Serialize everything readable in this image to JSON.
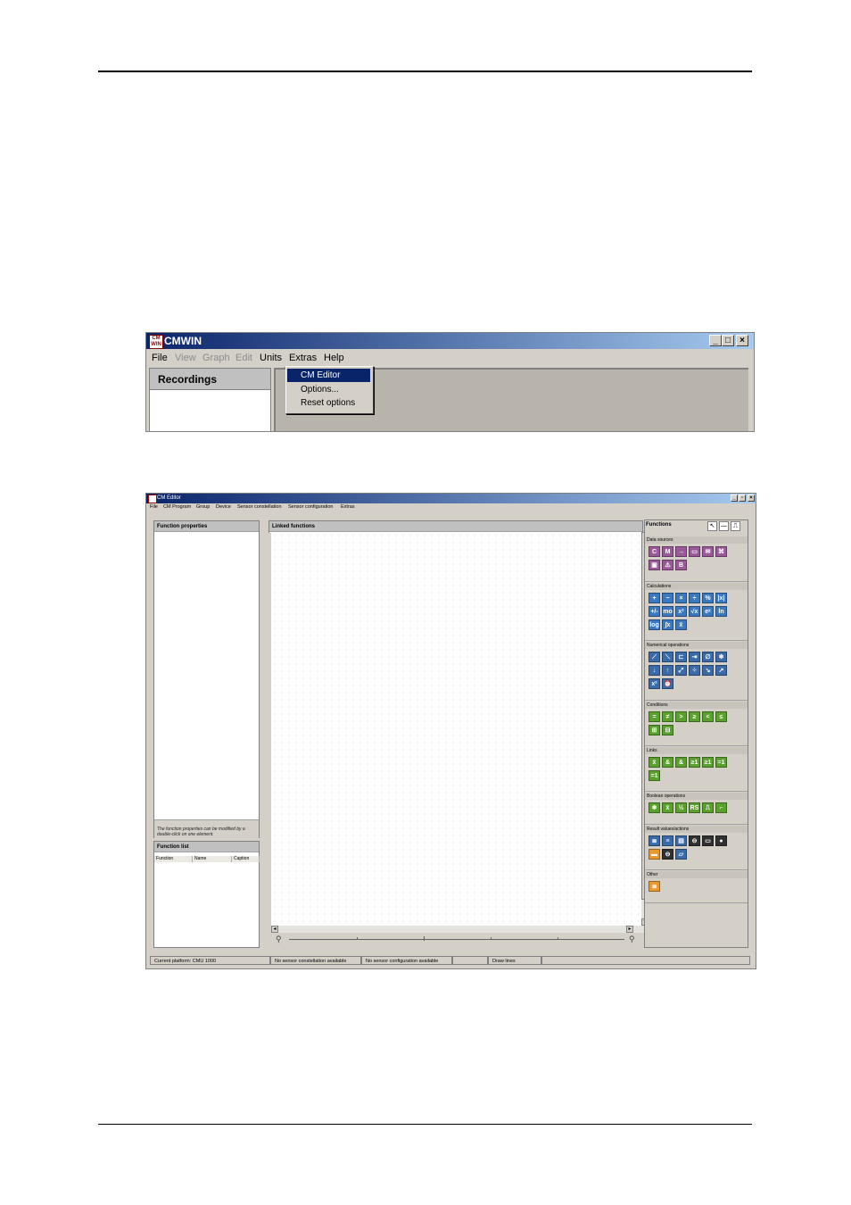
{
  "shot1": {
    "window_title": "CMWIN",
    "app_icon_text": "CM WIN",
    "menu": [
      "File",
      "View",
      "Graph",
      "Edit",
      "Units",
      "Extras",
      "Help"
    ],
    "recordings_label": "Recordings",
    "extras_dropdown": [
      "CM Editor",
      "Options...",
      "Reset options"
    ]
  },
  "shot2": {
    "window_title": "CM Editor",
    "menu": [
      "File",
      "CM Program",
      "Group",
      "Device",
      "Sensor constellation",
      "Sensor configuration",
      "Extras"
    ],
    "function_properties_title": "Function properties",
    "properties_hint": "The function properties can be modified by a double-click on one element.",
    "function_list_title": "Function list",
    "function_list_columns": [
      "Function",
      "Name",
      "Caption"
    ],
    "linked_functions_title": "Linked functions",
    "functions_title": "Functions",
    "groups": [
      {
        "title": "Data sources",
        "icons": [
          {
            "name": "constant-icon",
            "glyph": "C",
            "color": "pu"
          },
          {
            "name": "memory-icon",
            "glyph": "M",
            "color": "pu"
          },
          {
            "name": "input-icon",
            "glyph": "→",
            "color": "pu"
          },
          {
            "name": "sensor-icon",
            "glyph": "▭",
            "color": "pu"
          },
          {
            "name": "message-icon",
            "glyph": "✉",
            "color": "pu"
          },
          {
            "name": "channel-icon",
            "glyph": "⌘",
            "color": "pu"
          },
          {
            "name": "device-icon",
            "glyph": "▣",
            "color": "pu"
          },
          {
            "name": "warning-icon",
            "glyph": "⚠",
            "color": "pu"
          },
          {
            "name": "bit-icon",
            "glyph": "B",
            "color": "pu"
          }
        ]
      },
      {
        "title": "Calculations",
        "icons": [
          {
            "name": "add-icon",
            "glyph": "+",
            "color": "bl"
          },
          {
            "name": "subtract-icon",
            "glyph": "−",
            "color": "bl"
          },
          {
            "name": "multiply-icon",
            "glyph": "×",
            "color": "bl"
          },
          {
            "name": "divide-icon",
            "glyph": "÷",
            "color": "bl"
          },
          {
            "name": "percent-icon",
            "glyph": "%",
            "color": "bl"
          },
          {
            "name": "absolute-icon",
            "glyph": "|x|",
            "color": "bl"
          },
          {
            "name": "sign-icon",
            "glyph": "+/-",
            "color": "bl"
          },
          {
            "name": "modulo-icon",
            "glyph": "mo",
            "color": "bl"
          },
          {
            "name": "power-icon",
            "glyph": "x²",
            "color": "bl"
          },
          {
            "name": "sqrt-icon",
            "glyph": "√x",
            "color": "bl"
          },
          {
            "name": "exp-icon",
            "glyph": "eˣ",
            "color": "bl"
          },
          {
            "name": "ln-icon",
            "glyph": "ln",
            "color": "bl"
          },
          {
            "name": "log-icon",
            "glyph": "log",
            "color": "bl"
          },
          {
            "name": "integral-icon",
            "glyph": "∫x",
            "color": "bl"
          },
          {
            "name": "mean-icon",
            "glyph": "x̄",
            "color": "bl"
          }
        ]
      },
      {
        "title": "Numerical operations",
        "icons": [
          {
            "name": "ramp-up-icon",
            "glyph": "⟋",
            "color": "bl2"
          },
          {
            "name": "ramp-down-icon",
            "glyph": "⟍",
            "color": "bl2"
          },
          {
            "name": "step-icon",
            "glyph": "⊏",
            "color": "bl2"
          },
          {
            "name": "shift-icon",
            "glyph": "⇥",
            "color": "bl2"
          },
          {
            "name": "empty-icon",
            "glyph": "∅",
            "color": "bl2"
          },
          {
            "name": "freeze-icon",
            "glyph": "❄",
            "color": "bl2"
          },
          {
            "name": "min-icon",
            "glyph": "↓",
            "color": "bl2"
          },
          {
            "name": "max-icon",
            "glyph": "↑",
            "color": "bl2"
          },
          {
            "name": "scale-icon",
            "glyph": "⤢",
            "color": "bl2"
          },
          {
            "name": "scatter-icon",
            "glyph": "⁘",
            "color": "bl2"
          },
          {
            "name": "decay-icon",
            "glyph": "↘",
            "color": "bl2"
          },
          {
            "name": "trend-icon",
            "glyph": "↗",
            "color": "bl2"
          },
          {
            "name": "bits-icon",
            "glyph": "x²",
            "color": "bl2"
          },
          {
            "name": "timer-icon",
            "glyph": "⏰",
            "color": "bl2"
          }
        ]
      },
      {
        "title": "Conditions",
        "icons": [
          {
            "name": "equal-icon",
            "glyph": "=",
            "color": "gr"
          },
          {
            "name": "not-equal-icon",
            "glyph": "≠",
            "color": "gr"
          },
          {
            "name": "greater-icon",
            "glyph": ">",
            "color": "gr"
          },
          {
            "name": "greater-equal-icon",
            "glyph": "≥",
            "color": "gr"
          },
          {
            "name": "less-icon",
            "glyph": "<",
            "color": "gr"
          },
          {
            "name": "less-equal-icon",
            "glyph": "≤",
            "color": "gr"
          },
          {
            "name": "range-in-icon",
            "glyph": "⊞",
            "color": "gr"
          },
          {
            "name": "range-out-icon",
            "glyph": "⊟",
            "color": "gr"
          }
        ]
      },
      {
        "title": "Links",
        "icons": [
          {
            "name": "not-icon",
            "glyph": "x̄",
            "color": "gr"
          },
          {
            "name": "and-icon",
            "glyph": "&",
            "color": "gr"
          },
          {
            "name": "nand-icon",
            "glyph": "&",
            "color": "gr"
          },
          {
            "name": "or-icon",
            "glyph": "≥1",
            "color": "gr"
          },
          {
            "name": "nor-icon",
            "glyph": "≥1",
            "color": "gr"
          },
          {
            "name": "xor-icon",
            "glyph": "=1",
            "color": "gr"
          },
          {
            "name": "xnor-icon",
            "glyph": "=1",
            "color": "gr"
          }
        ]
      },
      {
        "title": "Boolean operations",
        "icons": [
          {
            "name": "bool-freeze-icon",
            "glyph": "❄",
            "color": "gr"
          },
          {
            "name": "bool-mean-icon",
            "glyph": "x̄",
            "color": "gr"
          },
          {
            "name": "toggle-icon",
            "glyph": "½",
            "color": "gr"
          },
          {
            "name": "rs-flipflop-icon",
            "glyph": "RS",
            "color": "gr"
          },
          {
            "name": "pulse-icon",
            "glyph": "⎍",
            "color": "gr"
          },
          {
            "name": "delay-icon",
            "glyph": "⌐",
            "color": "gr"
          }
        ]
      },
      {
        "title": "Result values/actions",
        "icons": [
          {
            "name": "result-table-icon",
            "glyph": "≣",
            "color": "bl2"
          },
          {
            "name": "result-list-icon",
            "glyph": "≡",
            "color": "bl2"
          },
          {
            "name": "output-icon",
            "glyph": "▤",
            "color": "bl2"
          },
          {
            "name": "relay-icon",
            "glyph": "⊖",
            "color": "dk"
          },
          {
            "name": "display-icon",
            "glyph": "▭",
            "color": "dk"
          },
          {
            "name": "lamp-icon",
            "glyph": "●",
            "color": "dk"
          },
          {
            "name": "store-icon",
            "glyph": "▬",
            "color": "or"
          },
          {
            "name": "relay-out-icon",
            "glyph": "⊖",
            "color": "dk"
          },
          {
            "name": "chart-icon",
            "glyph": "▱",
            "color": "bl2"
          }
        ]
      },
      {
        "title": "Other",
        "icons": [
          {
            "name": "note-icon",
            "glyph": "≣",
            "color": "or"
          }
        ]
      }
    ],
    "status": [
      "Current platform: CMU 1000",
      "No sensor constellation available",
      "No sensor configuration available",
      "",
      "Draw lines"
    ]
  }
}
